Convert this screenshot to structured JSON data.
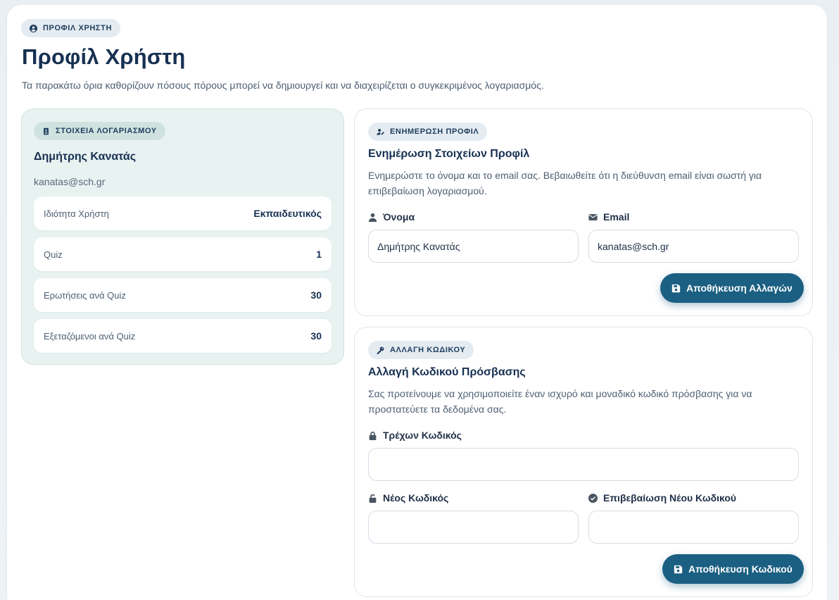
{
  "header": {
    "pill": "ΠΡΟΦΙΛ ΧΡΗΣΤΗ",
    "title": "Προφίλ Χρήστη",
    "description": "Τα παρακάτω όρια καθορίζουν πόσους πόρους μπορεί να δημιουργεί και να διαχειρίζεται ο συγκεκριμένος λογαριασμός."
  },
  "account": {
    "pill": "ΣΤΟΙΧΕΙΑ ΛΟΓΑΡΙΑΣΜΟΥ",
    "name": "Δημήτρης Κανατάς",
    "email": "kanatas@sch.gr",
    "stats": [
      {
        "label": "Ιδιότητα Χρήστη",
        "value": "Εκπαιδευτικός"
      },
      {
        "label": "Quiz",
        "value": "1"
      },
      {
        "label": "Ερωτήσεις ανά Quiz",
        "value": "30"
      },
      {
        "label": "Εξεταζόμενοι ανά Quiz",
        "value": "30"
      }
    ]
  },
  "profile_update": {
    "pill": "ΕΝΗΜΕΡΩΣΗ ΠΡΟΦΙΛ",
    "title": "Ενημέρωση Στοιχείων Προφίλ",
    "description": "Ενημερώστε το όνομα και το email σας. Βεβαιωθείτε ότι η διεύθυνση email είναι σωστή για επιβεβαίωση λογαριασμού.",
    "name_label": "Όνομα",
    "name_value": "Δημήτρης Κανατάς",
    "email_label": "Email",
    "email_value": "kanatas@sch.gr",
    "save_label": "Αποθήκευση Αλλαγών"
  },
  "password_change": {
    "pill": "ΑΛΛΑΓΗ ΚΩΔΙΚΟΥ",
    "title": "Αλλαγή Κωδικού Πρόσβασης",
    "description": "Σας προτείνουμε να χρησιμοποιείτε έναν ισχυρό και μοναδικό κωδικό πρόσβασης για να προστατεύετε τα δεδομένα σας.",
    "current_label": "Τρέχων Κωδικός",
    "new_label": "Νέος Κωδικός",
    "confirm_label": "Επιβεβαίωση Νέου Κωδικού",
    "save_label": "Αποθήκευση Κωδικού"
  },
  "colors": {
    "accent": "#1b5f82",
    "title": "#173052",
    "account_card_bg": "#e8f2f1"
  }
}
